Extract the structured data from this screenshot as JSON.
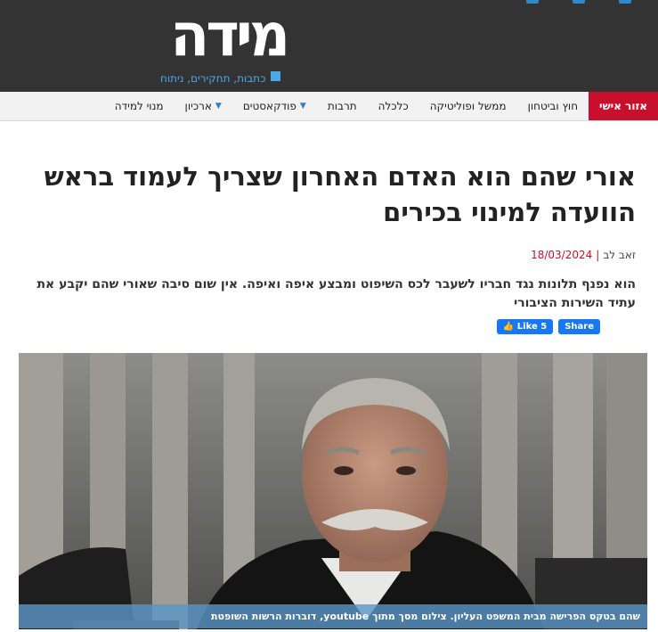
{
  "site": {
    "logo_text": "מידה",
    "tagline": "כתבות, תחקירים, ניתוח"
  },
  "social": [
    "social-icon",
    "social-icon",
    "social-icon"
  ],
  "nav": {
    "items": [
      {
        "label": "אזור אישי",
        "active": true,
        "dropdown": false
      },
      {
        "label": "חוץ וביטחון",
        "active": false,
        "dropdown": false
      },
      {
        "label": "ממשל ופוליטיקה",
        "active": false,
        "dropdown": false
      },
      {
        "label": "כלכלה",
        "active": false,
        "dropdown": false
      },
      {
        "label": "תרבות",
        "active": false,
        "dropdown": false
      },
      {
        "label": "פודקאסטים",
        "active": false,
        "dropdown": true
      },
      {
        "label": "ארכיון",
        "active": false,
        "dropdown": true
      },
      {
        "label": "מנוי למידה",
        "active": false,
        "dropdown": false
      }
    ]
  },
  "article": {
    "title": "אורי שהם הוא האדם האחרון שצריך לעמוד בראש הוועדה למינוי בכירים",
    "author": "זאב לב",
    "date": "18/03/2024",
    "lead": "הוא נפנף תלונות נגד חבריו לשעבר לכס השיפוט ומבצע איפה ואיפה. אין שום סיבה שאורי שהם יקבע את עתיד השירות הציבורי",
    "like_label": "Like 5",
    "share_label": "Share",
    "image_caption": "שהם בטקס הפרישה מבית המשפט העליון. צילום מסך מתוך youtube, דוברות הרשות השופטת"
  },
  "colors": {
    "header_bg": "#333333",
    "accent_red": "#c8102e",
    "accent_blue": "#4aa8e6",
    "facebook_blue": "#1877f2"
  }
}
